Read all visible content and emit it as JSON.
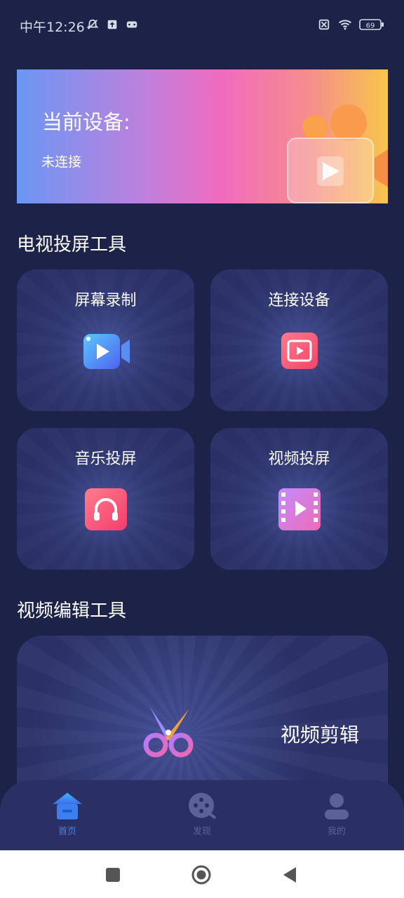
{
  "status_bar": {
    "time": "中午12:26",
    "battery": "69",
    "left_icons": [
      "mute-bell-icon",
      "upload-icon",
      "gamepad-icon"
    ],
    "right_icons": [
      "sim-off-icon",
      "wifi-icon",
      "battery-icon"
    ]
  },
  "banner": {
    "title": "当前设备:",
    "status": "未连接"
  },
  "sections": {
    "tv_tools": "电视投屏工具",
    "edit_tools": "视频编辑工具"
  },
  "cards": {
    "record": {
      "label": "屏幕录制",
      "icon": "video-camera-icon"
    },
    "connect": {
      "label": "连接设备",
      "icon": "screen-cast-icon"
    },
    "music": {
      "label": "音乐投屏",
      "icon": "headphones-icon"
    },
    "video": {
      "label": "视频投屏",
      "icon": "film-icon"
    }
  },
  "edit_card": {
    "label": "视频剪辑",
    "icon": "scissors-icon"
  },
  "bottom_nav": {
    "items": [
      {
        "label": "首页",
        "icon": "home-icon",
        "active": true
      },
      {
        "label": "发现",
        "icon": "discover-icon",
        "active": false
      },
      {
        "label": "我的",
        "icon": "profile-icon",
        "active": false
      }
    ]
  },
  "colors": {
    "background": "#1d2248",
    "card": "#2a3065",
    "nav_active": "#4a7fe0",
    "nav_inactive": "#5a6298"
  }
}
